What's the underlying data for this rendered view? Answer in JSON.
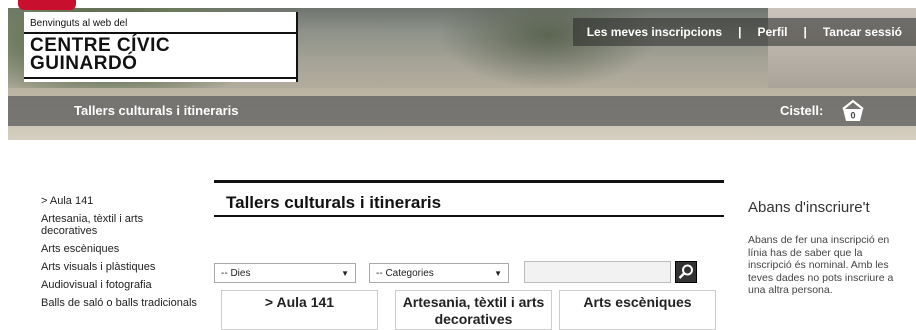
{
  "header": {
    "welcome": "Benvinguts al web del",
    "site_name_line1": "CENTRE CÍVIC",
    "site_name_line2": "GUINARDÓ",
    "nav": [
      {
        "label": "Les meves inscripcions"
      },
      {
        "label": "Perfil"
      },
      {
        "label": "Tancar sessió"
      }
    ],
    "nav_separator": "|",
    "section_title": "Tallers culturals i itineraris",
    "cart_label": "Cistell:",
    "cart_count": "0"
  },
  "sidebar": {
    "items": [
      "> Aula 141",
      "Artesania, tèxtil i arts decoratives",
      "Arts escèniques",
      "Arts visuals i plàstiques",
      "Audiovisual i fotografia",
      "Balls de saló o balls tradicionals"
    ]
  },
  "main": {
    "title": "Tallers culturals i itineraris",
    "filters": {
      "days": "-- Dies",
      "categories": "-- Categories",
      "search_value": ""
    },
    "tiles": [
      "> Aula 141",
      "Artesania, tèxtil i arts decoratives",
      "Arts escèniques"
    ]
  },
  "aside": {
    "heading": "Abans d'inscriure't",
    "text": "Abans de fer una inscripció en línia has de saber que la inscripció és nominal. Amb les teves dades no pots inscriure a una altra persona."
  }
}
